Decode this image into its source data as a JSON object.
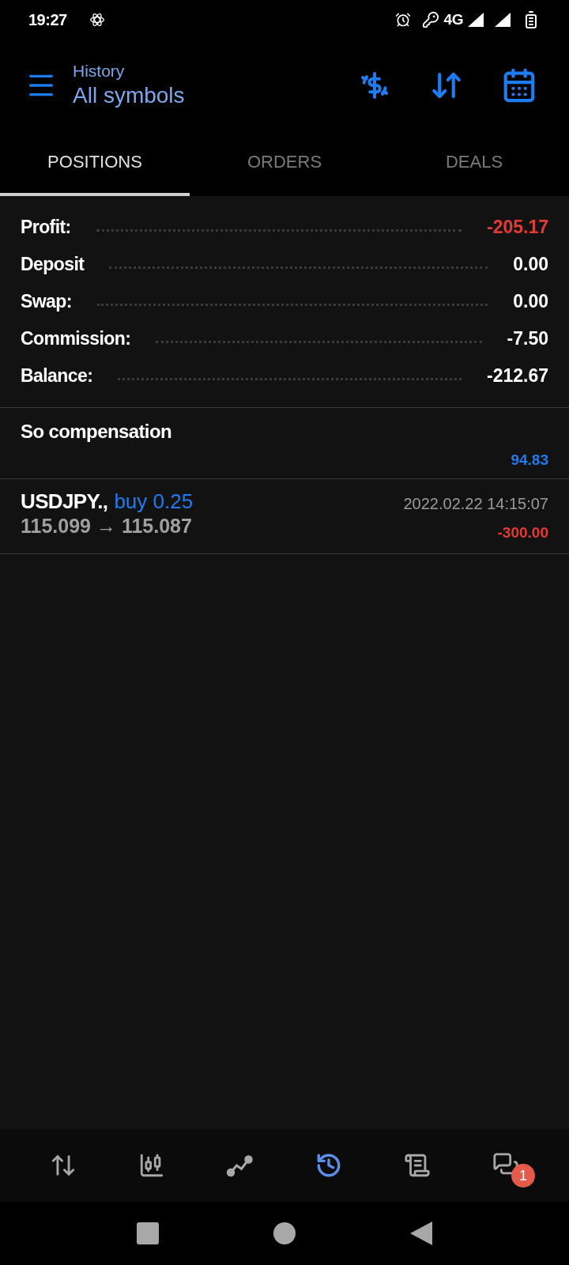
{
  "status_bar": {
    "time": "19:27",
    "network": "4G"
  },
  "header": {
    "subtitle": "History",
    "title": "All symbols"
  },
  "tabs": [
    {
      "label": "POSITIONS",
      "selected": true
    },
    {
      "label": "ORDERS",
      "selected": false
    },
    {
      "label": "DEALS",
      "selected": false
    }
  ],
  "summary": [
    {
      "label": "Profit:",
      "value": "-205.17",
      "color": "#e53935"
    },
    {
      "label": "Deposit",
      "value": "0.00",
      "color": "#ffffff"
    },
    {
      "label": "Swap:",
      "value": "0.00",
      "color": "#ffffff"
    },
    {
      "label": "Commission:",
      "value": "-7.50",
      "color": "#ffffff"
    },
    {
      "label": "Balance:",
      "value": "-212.67",
      "color": "#ffffff"
    }
  ],
  "compensation": {
    "title": "So compensation",
    "value": "94.83"
  },
  "positions": [
    {
      "symbol": "USDJPY.,",
      "side": "buy 0.25",
      "prices": "115.099 → 115.087",
      "time": "2022.02.22 14:15:07",
      "profit": "-300.00"
    }
  ],
  "bottom_nav": [
    {
      "kind": "quotes",
      "selected": false
    },
    {
      "kind": "chart",
      "selected": false
    },
    {
      "kind": "trade",
      "selected": false
    },
    {
      "kind": "history",
      "selected": true
    },
    {
      "kind": "journal",
      "selected": false
    },
    {
      "kind": "messages",
      "selected": false,
      "badge": "1"
    }
  ]
}
